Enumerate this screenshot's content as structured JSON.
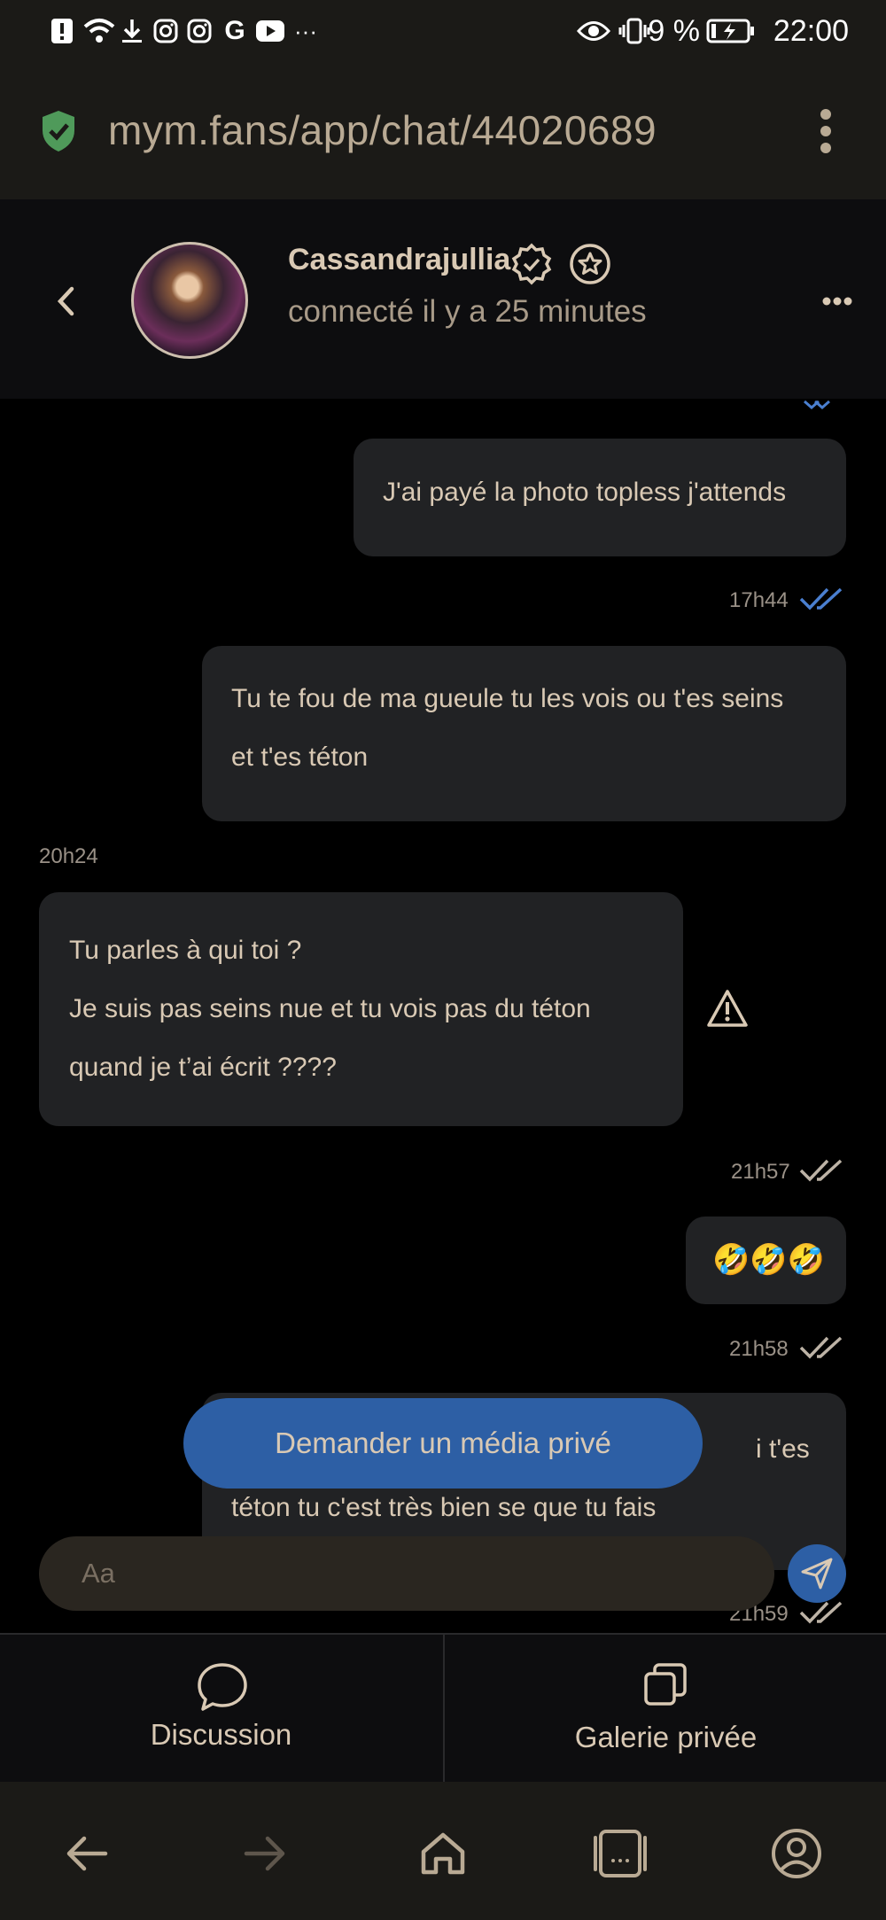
{
  "status_bar": {
    "time": "22:00",
    "battery": "9 %",
    "icons": [
      "alert-icon",
      "wifi-icon",
      "download-icon",
      "instagram-icon",
      "instagram-icon",
      "google-icon",
      "youtube-icon",
      "more-icon",
      "eye-icon",
      "vibrate-icon",
      "battery-charging-icon"
    ]
  },
  "browser": {
    "url": "mym.fans/app/chat/44020689",
    "menu_icon": "kebab-menu-icon",
    "secure_icon": "shield-check-icon"
  },
  "header": {
    "contact_name": "Cassandrajullia",
    "status": "connecté il y a 25 minutes",
    "badges": [
      "verified-icon",
      "star-icon"
    ]
  },
  "messages": [
    {
      "sender": "me",
      "lines": [
        "J'ai payé la photo topless j'attends"
      ],
      "time": "17h44",
      "read": true
    },
    {
      "sender": "me",
      "lines": [
        "Tu te fou de ma gueule tu les vois ou t'es seins",
        "et t'es téton"
      ]
    },
    {
      "sender": "them",
      "time_before": "20h24",
      "lines": [
        "Tu parles à qui toi ?",
        "Je suis pas seins nue et tu vois pas du téton",
        "quand je t’ai écrit ????"
      ]
    },
    {
      "sender": "me",
      "time_before": "21h57",
      "lines": [
        "🤣🤣🤣"
      ]
    },
    {
      "sender": "me",
      "time_before": "21h58",
      "lines": [
        "i t'es",
        "téton tu c'est très bien se que tu fais"
      ],
      "time_after": "21h59"
    }
  ],
  "actions": {
    "request_media": "Demander un média privé",
    "input_placeholder": "Aa"
  },
  "tabs": [
    {
      "label": "Discussion",
      "icon": "chat-bubble-icon"
    },
    {
      "label": "Galerie privée",
      "icon": "gallery-icon"
    }
  ],
  "nav": [
    "back-icon",
    "forward-icon",
    "home-icon",
    "tabs-icon",
    "account-icon"
  ],
  "colors": {
    "accent": "#2d5fa5",
    "bubble": "#212224",
    "text": "#d9c9b4",
    "check_read": "#4a7fd0"
  }
}
